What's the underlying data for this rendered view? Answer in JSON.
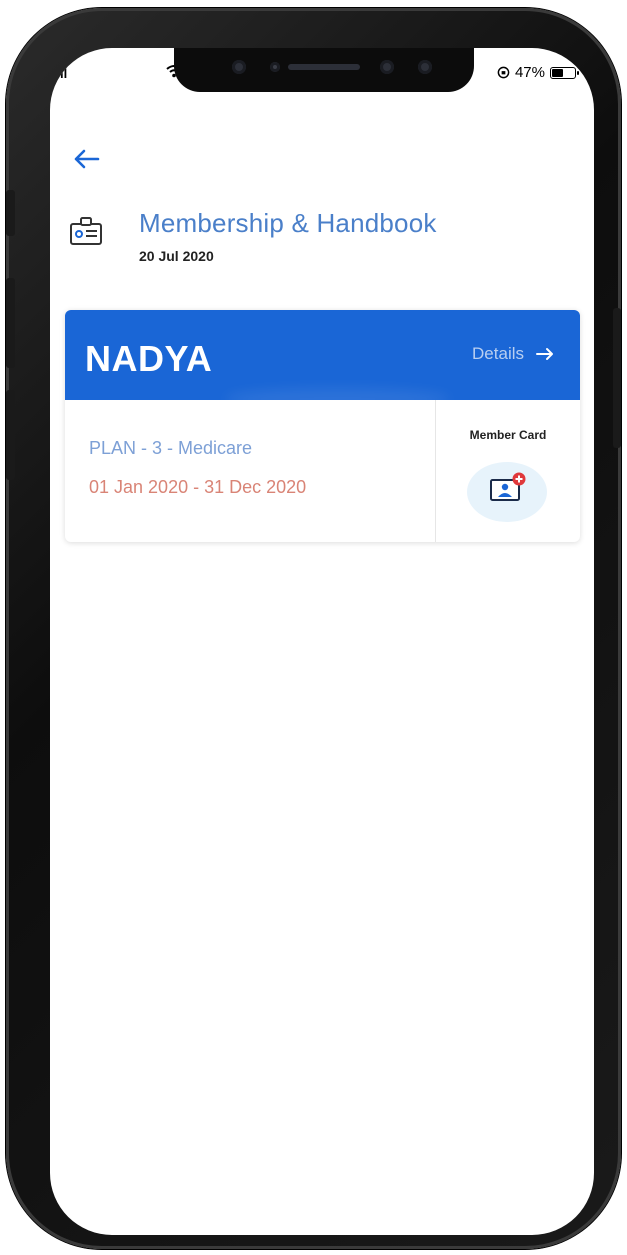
{
  "status_bar": {
    "signal": "ıl",
    "battery": "47%"
  },
  "header": {
    "title": "Membership & Handbook",
    "date": "20 Jul 2020"
  },
  "card": {
    "member_name": "NADYA",
    "details_label": "Details",
    "plan": "PLAN -  3 - Medicare",
    "period": "01 Jan 2020 - 31 Dec 2020",
    "member_card_label": "Member Card"
  },
  "colors": {
    "accent": "#1a66d6",
    "title": "#4a7fc9",
    "plan": "#7da0d6",
    "period": "#d98476"
  },
  "icons": {
    "back": "back-arrow-icon",
    "title": "id-card-icon",
    "details": "arrow-right-icon",
    "member_card": "member-card-icon"
  }
}
